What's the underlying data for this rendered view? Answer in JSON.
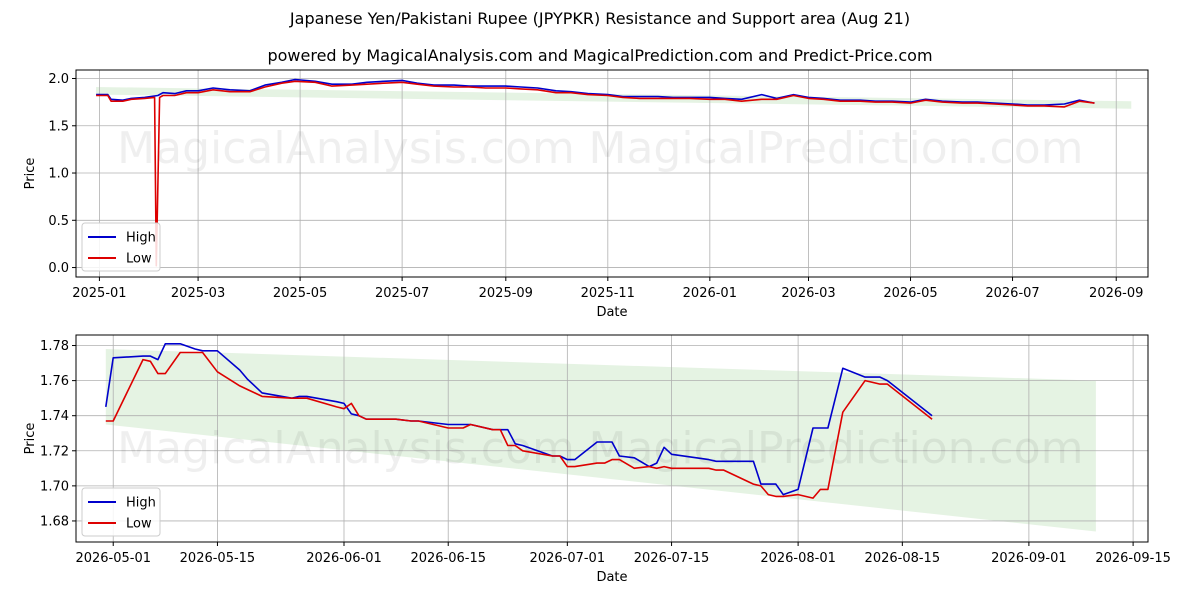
{
  "page": {
    "title": "Japanese Yen/Pakistani Rupee (JPYPKR) Resistance and Support area (Aug 21)",
    "subtitle": "powered by MagicalAnalysis.com and MagicalPrediction.com and Predict-Price.com",
    "watermarks": [
      "MagicalAnalysis.com",
      "MagicalPrediction.com"
    ]
  },
  "colors": {
    "high": "#0000cc",
    "low": "#dd0000",
    "band": "#d4ebd0",
    "grid": "#b0b0b0"
  },
  "chart_data": [
    {
      "type": "line",
      "xlabel": "Date",
      "ylabel": "Price",
      "xlim": [
        "2024-12-18",
        "2026-09-20"
      ],
      "ylim": [
        -0.1,
        2.09
      ],
      "grid": true,
      "legend_position": "lower-left",
      "x_ticks": [
        "2025-01",
        "2025-03",
        "2025-05",
        "2025-07",
        "2025-09",
        "2025-11",
        "2026-01",
        "2026-03",
        "2026-05",
        "2026-07",
        "2026-09"
      ],
      "x_tick_dates": [
        "2025-01-01",
        "2025-03-01",
        "2025-05-01",
        "2025-07-01",
        "2025-09-01",
        "2025-11-01",
        "2026-01-01",
        "2026-03-01",
        "2026-05-01",
        "2026-07-01",
        "2026-09-01"
      ],
      "y_ticks": [
        0.0,
        0.5,
        1.0,
        1.5,
        2.0
      ],
      "y_tick_labels": [
        "0.0",
        "0.5",
        "1.0",
        "1.5",
        "2.0"
      ],
      "band": {
        "x": [
          "2024-12-30",
          "2026-09-10"
        ],
        "upper": [
          1.91,
          1.76
        ],
        "lower": [
          1.83,
          1.68
        ]
      },
      "series": [
        {
          "name": "High",
          "x": [
            "2024-12-30",
            "2025-01-06",
            "2025-01-08",
            "2025-01-15",
            "2025-01-20",
            "2025-01-28",
            "2025-02-05",
            "2025-02-08",
            "2025-02-15",
            "2025-02-22",
            "2025-03-01",
            "2025-03-10",
            "2025-03-20",
            "2025-04-01",
            "2025-04-10",
            "2025-04-20",
            "2025-04-28",
            "2025-05-10",
            "2025-05-20",
            "2025-06-01",
            "2025-06-10",
            "2025-06-20",
            "2025-07-01",
            "2025-07-10",
            "2025-07-20",
            "2025-08-01",
            "2025-08-10",
            "2025-08-20",
            "2025-09-01",
            "2025-09-10",
            "2025-09-20",
            "2025-10-01",
            "2025-10-10",
            "2025-10-20",
            "2025-11-01",
            "2025-11-10",
            "2025-11-20",
            "2025-12-01",
            "2025-12-10",
            "2025-12-20",
            "2026-01-01",
            "2026-01-10",
            "2026-01-20",
            "2026-02-01",
            "2026-02-10",
            "2026-02-20",
            "2026-03-01",
            "2026-03-10",
            "2026-03-20",
            "2026-04-01",
            "2026-04-10",
            "2026-04-20",
            "2026-05-01",
            "2026-05-10",
            "2026-05-20",
            "2026-06-01",
            "2026-06-10",
            "2026-06-20",
            "2026-07-01",
            "2026-07-10",
            "2026-07-20",
            "2026-08-01",
            "2026-08-10",
            "2026-08-19"
          ],
          "y": [
            1.83,
            1.83,
            1.78,
            1.77,
            1.79,
            1.8,
            1.82,
            1.85,
            1.84,
            1.87,
            1.87,
            1.9,
            1.88,
            1.87,
            1.93,
            1.96,
            1.99,
            1.97,
            1.94,
            1.94,
            1.96,
            1.97,
            1.98,
            1.95,
            1.93,
            1.93,
            1.92,
            1.92,
            1.92,
            1.91,
            1.9,
            1.87,
            1.86,
            1.84,
            1.83,
            1.81,
            1.81,
            1.81,
            1.8,
            1.8,
            1.8,
            1.79,
            1.78,
            1.83,
            1.79,
            1.83,
            1.8,
            1.79,
            1.77,
            1.77,
            1.76,
            1.76,
            1.75,
            1.78,
            1.76,
            1.75,
            1.75,
            1.74,
            1.73,
            1.72,
            1.72,
            1.73,
            1.77,
            1.74
          ]
        },
        {
          "name": "Low",
          "x": [
            "2024-12-30",
            "2025-01-06",
            "2025-01-08",
            "2025-01-15",
            "2025-01-20",
            "2025-01-28",
            "2025-02-03",
            "2025-02-04",
            "2025-02-06",
            "2025-02-08",
            "2025-02-15",
            "2025-02-22",
            "2025-03-01",
            "2025-03-10",
            "2025-03-20",
            "2025-04-01",
            "2025-04-10",
            "2025-04-20",
            "2025-04-28",
            "2025-05-10",
            "2025-05-20",
            "2025-06-01",
            "2025-06-10",
            "2025-06-20",
            "2025-07-01",
            "2025-07-10",
            "2025-07-20",
            "2025-08-01",
            "2025-08-10",
            "2025-08-20",
            "2025-09-01",
            "2025-09-10",
            "2025-09-20",
            "2025-10-01",
            "2025-10-10",
            "2025-10-20",
            "2025-11-01",
            "2025-11-10",
            "2025-11-20",
            "2025-12-01",
            "2025-12-10",
            "2025-12-20",
            "2026-01-01",
            "2026-01-10",
            "2026-01-20",
            "2026-02-01",
            "2026-02-10",
            "2026-02-20",
            "2026-03-01",
            "2026-03-10",
            "2026-03-20",
            "2026-04-01",
            "2026-04-10",
            "2026-04-20",
            "2026-05-01",
            "2026-05-10",
            "2026-05-20",
            "2026-06-01",
            "2026-06-10",
            "2026-06-20",
            "2026-07-01",
            "2026-07-10",
            "2026-07-20",
            "2026-08-01",
            "2026-08-10",
            "2026-08-19"
          ],
          "y": [
            1.82,
            1.82,
            1.76,
            1.76,
            1.78,
            1.79,
            1.8,
            0.02,
            1.8,
            1.82,
            1.82,
            1.85,
            1.85,
            1.88,
            1.86,
            1.86,
            1.91,
            1.95,
            1.97,
            1.96,
            1.92,
            1.93,
            1.94,
            1.95,
            1.96,
            1.94,
            1.92,
            1.91,
            1.91,
            1.9,
            1.9,
            1.89,
            1.88,
            1.85,
            1.85,
            1.83,
            1.82,
            1.8,
            1.79,
            1.79,
            1.79,
            1.79,
            1.78,
            1.78,
            1.76,
            1.78,
            1.78,
            1.82,
            1.79,
            1.78,
            1.76,
            1.76,
            1.75,
            1.75,
            1.74,
            1.77,
            1.75,
            1.74,
            1.74,
            1.73,
            1.72,
            1.71,
            1.71,
            1.7,
            1.76,
            1.74
          ]
        }
      ]
    },
    {
      "type": "line",
      "xlabel": "Date",
      "ylabel": "Price",
      "xlim": [
        "2026-04-26",
        "2026-09-17"
      ],
      "ylim": [
        1.668,
        1.786
      ],
      "grid": true,
      "legend_position": "lower-left",
      "x_ticks": [
        "2026-05-01",
        "2026-05-15",
        "2026-06-01",
        "2026-06-15",
        "2026-07-01",
        "2026-07-15",
        "2026-08-01",
        "2026-08-15",
        "2026-09-01",
        "2026-09-15"
      ],
      "y_ticks": [
        1.68,
        1.7,
        1.72,
        1.74,
        1.76,
        1.78
      ],
      "y_tick_labels": [
        "1.68",
        "1.70",
        "1.72",
        "1.74",
        "1.76",
        "1.78"
      ],
      "band": {
        "x": [
          "2026-04-30",
          "2026-09-10"
        ],
        "upper": [
          1.778,
          1.76
        ],
        "lower": [
          1.735,
          1.674
        ]
      },
      "series": [
        {
          "name": "High",
          "x": [
            "2026-04-30",
            "2026-05-01",
            "2026-05-05",
            "2026-05-06",
            "2026-05-07",
            "2026-05-08",
            "2026-05-10",
            "2026-05-12",
            "2026-05-13",
            "2026-05-15",
            "2026-05-18",
            "2026-05-19",
            "2026-05-20",
            "2026-05-21",
            "2026-05-25",
            "2026-05-26",
            "2026-05-27",
            "2026-05-31",
            "2026-06-01",
            "2026-06-02",
            "2026-06-03",
            "2026-06-04",
            "2026-06-08",
            "2026-06-10",
            "2026-06-11",
            "2026-06-15",
            "2026-06-17",
            "2026-06-18",
            "2026-06-21",
            "2026-06-22",
            "2026-06-23",
            "2026-06-24",
            "2026-06-25",
            "2026-06-29",
            "2026-06-30",
            "2026-07-01",
            "2026-07-02",
            "2026-07-05",
            "2026-07-06",
            "2026-07-07",
            "2026-07-08",
            "2026-07-10",
            "2026-07-12",
            "2026-07-13",
            "2026-07-14",
            "2026-07-15",
            "2026-07-20",
            "2026-07-21",
            "2026-07-22",
            "2026-07-26",
            "2026-07-27",
            "2026-07-28",
            "2026-07-29",
            "2026-07-30",
            "2026-08-01",
            "2026-08-03",
            "2026-08-04",
            "2026-08-05",
            "2026-08-07",
            "2026-08-10",
            "2026-08-12",
            "2026-08-13",
            "2026-08-19"
          ],
          "y": [
            1.745,
            1.773,
            1.774,
            1.774,
            1.772,
            1.781,
            1.781,
            1.778,
            1.777,
            1.777,
            1.766,
            1.761,
            1.757,
            1.753,
            1.75,
            1.751,
            1.751,
            1.748,
            1.747,
            1.741,
            1.74,
            1.738,
            1.738,
            1.737,
            1.737,
            1.735,
            1.735,
            1.735,
            1.732,
            1.732,
            1.732,
            1.724,
            1.723,
            1.717,
            1.717,
            1.715,
            1.715,
            1.725,
            1.725,
            1.725,
            1.717,
            1.716,
            1.711,
            1.713,
            1.722,
            1.718,
            1.715,
            1.714,
            1.714,
            1.714,
            1.701,
            1.701,
            1.701,
            1.695,
            1.698,
            1.733,
            1.733,
            1.733,
            1.767,
            1.762,
            1.762,
            1.76,
            1.74
          ]
        },
        {
          "name": "Low",
          "x": [
            "2026-04-30",
            "2026-05-01",
            "2026-05-05",
            "2026-05-06",
            "2026-05-07",
            "2026-05-08",
            "2026-05-10",
            "2026-05-12",
            "2026-05-13",
            "2026-05-15",
            "2026-05-18",
            "2026-05-19",
            "2026-05-20",
            "2026-05-21",
            "2026-05-25",
            "2026-05-26",
            "2026-05-27",
            "2026-05-31",
            "2026-06-01",
            "2026-06-02",
            "2026-06-03",
            "2026-06-04",
            "2026-06-08",
            "2026-06-10",
            "2026-06-11",
            "2026-06-15",
            "2026-06-17",
            "2026-06-18",
            "2026-06-21",
            "2026-06-22",
            "2026-06-23",
            "2026-06-24",
            "2026-06-25",
            "2026-06-29",
            "2026-06-30",
            "2026-07-01",
            "2026-07-02",
            "2026-07-05",
            "2026-07-06",
            "2026-07-07",
            "2026-07-08",
            "2026-07-10",
            "2026-07-12",
            "2026-07-13",
            "2026-07-14",
            "2026-07-15",
            "2026-07-20",
            "2026-07-21",
            "2026-07-22",
            "2026-07-26",
            "2026-07-27",
            "2026-07-28",
            "2026-07-29",
            "2026-07-30",
            "2026-08-01",
            "2026-08-03",
            "2026-08-04",
            "2026-08-05",
            "2026-08-07",
            "2026-08-10",
            "2026-08-12",
            "2026-08-13",
            "2026-08-19"
          ],
          "y": [
            1.737,
            1.737,
            1.772,
            1.771,
            1.764,
            1.764,
            1.776,
            1.776,
            1.776,
            1.765,
            1.757,
            1.755,
            1.753,
            1.751,
            1.75,
            1.75,
            1.75,
            1.745,
            1.744,
            1.747,
            1.74,
            1.738,
            1.738,
            1.737,
            1.737,
            1.733,
            1.733,
            1.735,
            1.732,
            1.732,
            1.723,
            1.723,
            1.72,
            1.717,
            1.717,
            1.711,
            1.711,
            1.713,
            1.713,
            1.715,
            1.715,
            1.71,
            1.711,
            1.71,
            1.711,
            1.71,
            1.71,
            1.709,
            1.709,
            1.701,
            1.7,
            1.695,
            1.694,
            1.694,
            1.695,
            1.693,
            1.698,
            1.698,
            1.742,
            1.76,
            1.758,
            1.758,
            1.738
          ]
        }
      ]
    }
  ]
}
